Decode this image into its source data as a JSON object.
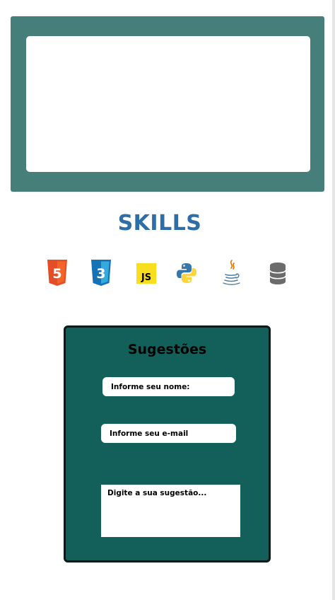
{
  "skills": {
    "title": "SKILLS",
    "icons": [
      {
        "name": "html5-icon",
        "label": "5",
        "color": "#e44d26"
      },
      {
        "name": "css3-icon",
        "label": "3",
        "color": "#1572b6"
      },
      {
        "name": "javascript-icon",
        "label": "JS",
        "color": "#f7df1e"
      },
      {
        "name": "python-icon",
        "color": "#3776ab"
      },
      {
        "name": "java-icon",
        "color": "#5382a1"
      },
      {
        "name": "database-icon",
        "color": "#6b6b6b"
      }
    ]
  },
  "form": {
    "title": "Sugestões",
    "name_placeholder": "Informe seu nome:",
    "email_placeholder": "Informe seu e-mail",
    "suggestion_placeholder": "Digite a sua sugestão..."
  },
  "colors": {
    "frame": "#467f7a",
    "form_bg": "#126059",
    "skills_title": "#2d6da8"
  }
}
